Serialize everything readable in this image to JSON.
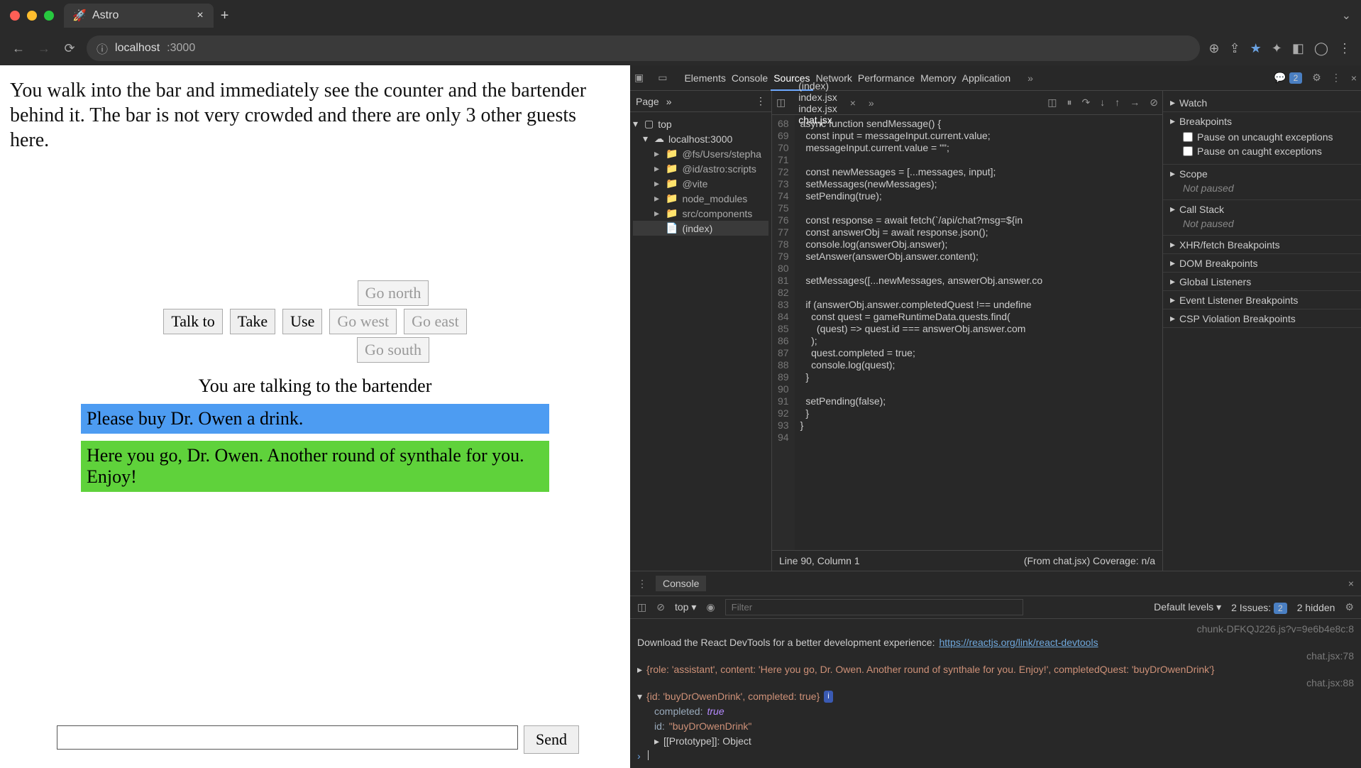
{
  "browser": {
    "tab_title": "Astro",
    "url_host": "localhost",
    "url_path": ":3000"
  },
  "game": {
    "description": "You walk into the bar and immediately see the counter and the bartender behind it. The bar is not very crowded and there are only 3 other guests here.",
    "buttons": {
      "talk_to": "Talk to",
      "take": "Take",
      "use": "Use",
      "north": "Go north",
      "south": "Go south",
      "east": "Go east",
      "west": "Go west"
    },
    "talking_to": "You are talking to the bartender",
    "messages": [
      {
        "role": "user",
        "text": "Please buy Dr. Owen a drink."
      },
      {
        "role": "assistant",
        "text": "Here you go, Dr. Owen. Another round of synthale for you. Enjoy!"
      }
    ],
    "send_label": "Send"
  },
  "devtools": {
    "tabs": [
      "Elements",
      "Console",
      "Sources",
      "Network",
      "Performance",
      "Memory",
      "Application"
    ],
    "active_tab": "Sources",
    "issues_badge": "2",
    "nav": {
      "header_tab": "Page",
      "tree": {
        "top": "top",
        "host": "localhost:3000",
        "items": [
          "@fs/Users/stepha",
          "@id/astro:scripts",
          "@vite",
          "node_modules",
          "src/components"
        ],
        "index_label": "(index)"
      }
    },
    "file_tabs": [
      "(index)",
      "index.jsx",
      "index.jsx",
      "chat.jsx"
    ],
    "active_file_tab": "chat.jsx",
    "code_lines": [
      {
        "n": 68,
        "t": "async function sendMessage() {"
      },
      {
        "n": 69,
        "t": "  const input = messageInput.current.value;"
      },
      {
        "n": 70,
        "t": "  messageInput.current.value = \"\";"
      },
      {
        "n": 71,
        "t": ""
      },
      {
        "n": 72,
        "t": "  const newMessages = [...messages, input];"
      },
      {
        "n": 73,
        "t": "  setMessages(newMessages);"
      },
      {
        "n": 74,
        "t": "  setPending(true);"
      },
      {
        "n": 75,
        "t": ""
      },
      {
        "n": 76,
        "t": "  const response = await fetch(`/api/chat?msg=${in"
      },
      {
        "n": 77,
        "t": "  const answerObj = await response.json();"
      },
      {
        "n": 78,
        "t": "  console.log(answerObj.answer);"
      },
      {
        "n": 79,
        "t": "  setAnswer(answerObj.answer.content);"
      },
      {
        "n": 80,
        "t": ""
      },
      {
        "n": 81,
        "t": "  setMessages([...newMessages, answerObj.answer.co"
      },
      {
        "n": 82,
        "t": ""
      },
      {
        "n": 83,
        "t": "  if (answerObj.answer.completedQuest !== undefine"
      },
      {
        "n": 84,
        "t": "    const quest = gameRuntimeData.quests.find("
      },
      {
        "n": 85,
        "t": "      (quest) => quest.id === answerObj.answer.com"
      },
      {
        "n": 86,
        "t": "    );"
      },
      {
        "n": 87,
        "t": "    quest.completed = true;"
      },
      {
        "n": 88,
        "t": "    console.log(quest);"
      },
      {
        "n": 89,
        "t": "  }"
      },
      {
        "n": 90,
        "t": ""
      },
      {
        "n": 91,
        "t": "  setPending(false);"
      },
      {
        "n": 92,
        "t": "  }"
      },
      {
        "n": 93,
        "t": "}"
      },
      {
        "n": 94,
        "t": ""
      }
    ],
    "status": {
      "pos": "Line 90, Column 1",
      "from": "(From chat.jsx)",
      "coverage": "Coverage: n/a"
    },
    "right_panel": {
      "sections": [
        "Watch",
        "Breakpoints",
        "Scope",
        "Call Stack",
        "XHR/fetch Breakpoints",
        "DOM Breakpoints",
        "Global Listeners",
        "Event Listener Breakpoints",
        "CSP Violation Breakpoints"
      ],
      "breakpoint_opts": [
        "Pause on uncaught exceptions",
        "Pause on caught exceptions"
      ],
      "not_paused": "Not paused"
    },
    "console": {
      "title": "Console",
      "context": "top",
      "filter_placeholder": "Filter",
      "levels": "Default levels",
      "issues_label": "2 Issues:",
      "issues_count": "2",
      "hidden": "2 hidden",
      "chunk_src": "chunk-DFKQJ226.js?v=9e6b4e8c:8",
      "react_msg": "Download the React DevTools for a better development experience: ",
      "react_link": "https://reactjs.org/link/react-devtools",
      "log1_src": "chat.jsx:78",
      "log1": "{role: 'assistant', content: 'Here you go, Dr. Owen. Another round of synthale for you. Enjoy!', completedQuest: 'buyDrOwenDrink'}",
      "log2_src": "chat.jsx:88",
      "log2_head": "{id: 'buyDrOwenDrink', completed: true}",
      "log2_completed_k": "completed:",
      "log2_completed_v": "true",
      "log2_id_k": "id:",
      "log2_id_v": "\"buyDrOwenDrink\"",
      "log2_proto": "[[Prototype]]: Object"
    }
  }
}
